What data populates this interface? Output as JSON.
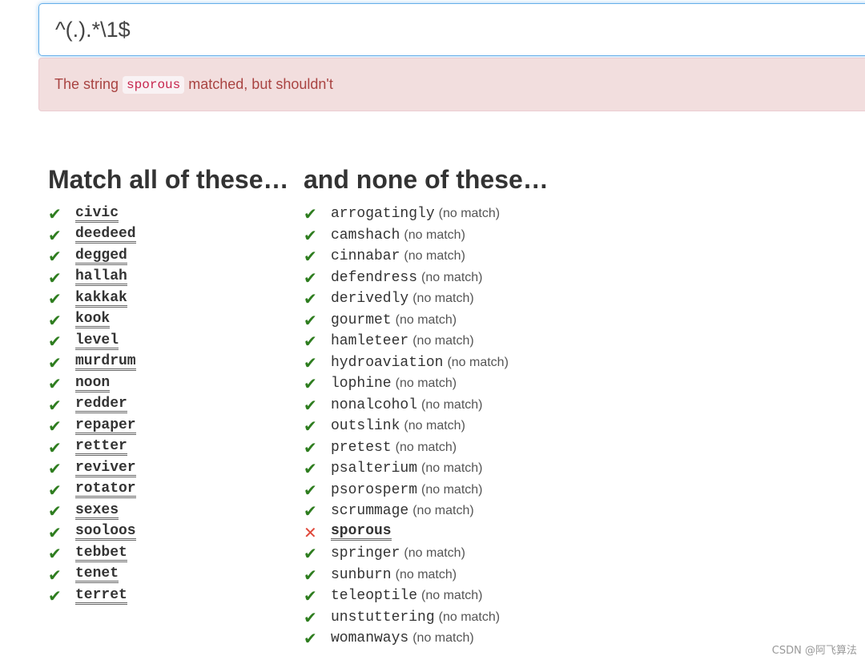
{
  "regex": {
    "value": "^(.).*\\1$"
  },
  "alert": {
    "prefix": "The string",
    "word": "sporous",
    "suffix": "matched, but shouldn't"
  },
  "match_column": {
    "heading": "Match all of these…",
    "items": [
      {
        "word": "civic",
        "status": "ok"
      },
      {
        "word": "deedeed",
        "status": "ok"
      },
      {
        "word": "degged",
        "status": "ok"
      },
      {
        "word": "hallah",
        "status": "ok"
      },
      {
        "word": "kakkak",
        "status": "ok"
      },
      {
        "word": "kook",
        "status": "ok"
      },
      {
        "word": "level",
        "status": "ok"
      },
      {
        "word": "murdrum",
        "status": "ok"
      },
      {
        "word": "noon",
        "status": "ok"
      },
      {
        "word": "redder",
        "status": "ok"
      },
      {
        "word": "repaper",
        "status": "ok"
      },
      {
        "word": "retter",
        "status": "ok"
      },
      {
        "word": "reviver",
        "status": "ok"
      },
      {
        "word": "rotator",
        "status": "ok"
      },
      {
        "word": "sexes",
        "status": "ok"
      },
      {
        "word": "sooloos",
        "status": "ok"
      },
      {
        "word": "tebbet",
        "status": "ok"
      },
      {
        "word": "tenet",
        "status": "ok"
      },
      {
        "word": "terret",
        "status": "ok"
      }
    ]
  },
  "nomatch_column": {
    "heading": "and none of these…",
    "no_match_label": "(no match)",
    "items": [
      {
        "word": "arrogatingly",
        "status": "ok"
      },
      {
        "word": "camshach",
        "status": "ok"
      },
      {
        "word": "cinnabar",
        "status": "ok"
      },
      {
        "word": "defendress",
        "status": "ok"
      },
      {
        "word": "derivedly",
        "status": "ok"
      },
      {
        "word": "gourmet",
        "status": "ok"
      },
      {
        "word": "hamleteer",
        "status": "ok"
      },
      {
        "word": "hydroaviation",
        "status": "ok"
      },
      {
        "word": "lophine",
        "status": "ok"
      },
      {
        "word": "nonalcohol",
        "status": "ok"
      },
      {
        "word": "outslink",
        "status": "ok"
      },
      {
        "word": "pretest",
        "status": "ok"
      },
      {
        "word": "psalterium",
        "status": "ok"
      },
      {
        "word": "psorosperm",
        "status": "ok"
      },
      {
        "word": "scrummage",
        "status": "ok"
      },
      {
        "word": "sporous",
        "status": "bad"
      },
      {
        "word": "springer",
        "status": "ok"
      },
      {
        "word": "sunburn",
        "status": "ok"
      },
      {
        "word": "teleoptile",
        "status": "ok"
      },
      {
        "word": "unstuttering",
        "status": "ok"
      },
      {
        "word": "womanways",
        "status": "ok"
      }
    ]
  },
  "icons": {
    "ok": "✔",
    "bad": "✕",
    "ok_color": "#2e7d1f",
    "bad_color": "#e0483a"
  },
  "watermark": "CSDN @阿飞算法"
}
